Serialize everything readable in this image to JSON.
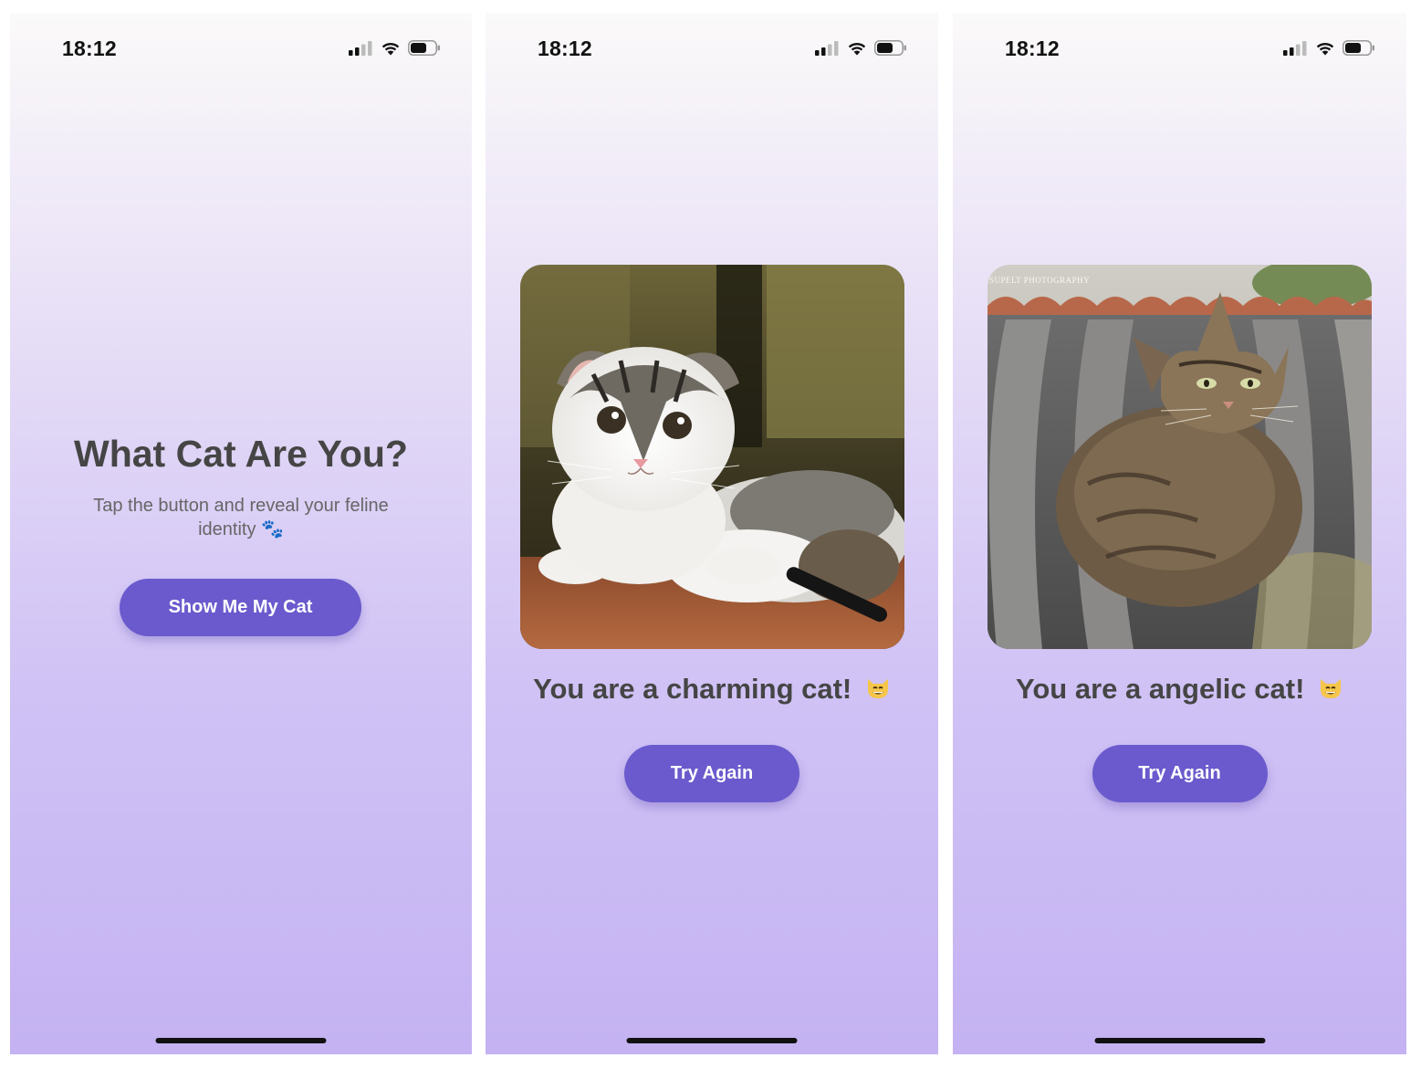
{
  "status_bar": {
    "time": "18:12",
    "icons": [
      "cellular-signal-icon",
      "wifi-icon",
      "battery-icon"
    ]
  },
  "screen_intro": {
    "title": "What Cat Are You?",
    "subtitle": "Tap the button and reveal your feline identity 🐾",
    "button_label": "Show Me My Cat"
  },
  "screen_result_1": {
    "result_text": "You are a charming cat!",
    "emoji_icon": "grinning-cat-icon",
    "button_label": "Try Again",
    "photo": "kitten-photo"
  },
  "screen_result_2": {
    "result_text": "You are a angelic cat!",
    "emoji_icon": "grinning-cat-icon",
    "button_label": "Try Again",
    "photo": "tabby-cat-on-roof-photo",
    "photo_watermark": "SUPELT PHOTOGRAPHY"
  },
  "colors": {
    "accent": "#6a5acd",
    "title_text": "#454545",
    "subtitle_text": "#666666",
    "gradient_top": "#fbfaf9",
    "gradient_bottom": "#c4b2f2"
  }
}
